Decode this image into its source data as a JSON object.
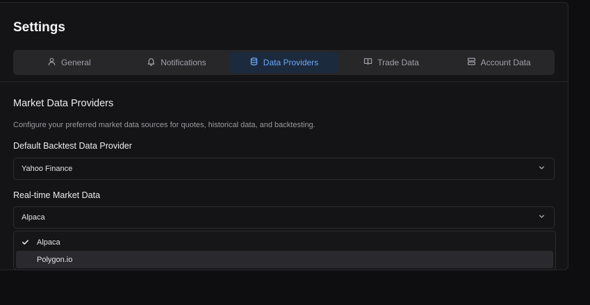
{
  "page": {
    "title": "Settings"
  },
  "tabs": [
    {
      "label": "General",
      "icon": "user-icon",
      "active": false
    },
    {
      "label": "Notifications",
      "icon": "bell-icon",
      "active": false
    },
    {
      "label": "Data Providers",
      "icon": "database-icon",
      "active": true
    },
    {
      "label": "Trade Data",
      "icon": "book-icon",
      "active": false
    },
    {
      "label": "Account Data",
      "icon": "server-icon",
      "active": false
    }
  ],
  "section": {
    "title": "Market Data Providers",
    "description": "Configure your preferred market data sources for quotes, historical data, and backtesting."
  },
  "backtest": {
    "label": "Default Backtest Data Provider",
    "value": "Yahoo Finance"
  },
  "realtime": {
    "label": "Real-time Market Data",
    "value": "Alpaca",
    "options": [
      {
        "label": "Alpaca",
        "selected": true
      },
      {
        "label": "Polygon.io",
        "selected": false
      }
    ]
  },
  "colors": {
    "accent": "#6ea8f7",
    "active_tab_bg": "#1c2a3e",
    "background": "#0e0e10"
  }
}
